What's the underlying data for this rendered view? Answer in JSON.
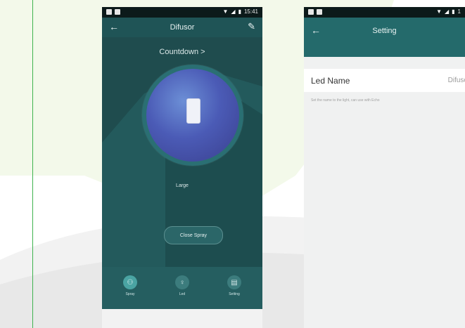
{
  "status_bar": {
    "time_left": "15:41",
    "time_right": "1"
  },
  "phone1": {
    "title": "Difusor",
    "countdown_label": "Countdown >",
    "mode_label": "Large",
    "close_button": "Close Spray",
    "nav": [
      {
        "label": "Spray",
        "icon": "share-icon"
      },
      {
        "label": "Led",
        "icon": "bulb-icon"
      },
      {
        "label": "Setting",
        "icon": "settings-icon"
      }
    ],
    "colors": {
      "primary": "#1f4c4e",
      "accent": "#4aa4a3"
    }
  },
  "phone2": {
    "title": "Setting",
    "row_label": "Led Name",
    "row_value": "Difuso",
    "hint": "Set the name to the light, can use with Echo",
    "colors": {
      "header": "#246a6b"
    }
  }
}
